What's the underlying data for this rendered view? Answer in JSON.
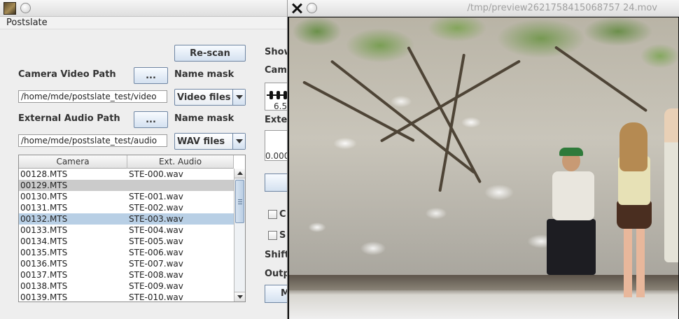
{
  "main_window": {
    "menu": {
      "app_menu": "Postslate"
    },
    "rescan_label": "Re-scan",
    "camera": {
      "path_label": "Camera Video Path",
      "browse_label": "...",
      "name_mask_label": "Name mask",
      "path_value": "/home/mde/postslate_test/video",
      "mask_value": "Video files"
    },
    "audio": {
      "path_label": "External Audio Path",
      "browse_label": "...",
      "name_mask_label": "Name mask",
      "path_value": "/home/mde/postslate_test/audio",
      "mask_value": "WAV files"
    },
    "table": {
      "columns": [
        "Camera",
        "Ext. Audio"
      ],
      "rows": [
        [
          "00128.MTS",
          "STE-000.wav"
        ],
        [
          "00129.MTS",
          ""
        ],
        [
          "00130.MTS",
          "STE-001.wav"
        ],
        [
          "00131.MTS",
          "STE-002.wav"
        ],
        [
          "00132.MTS",
          "STE-003.wav"
        ],
        [
          "00133.MTS",
          "STE-004.wav"
        ],
        [
          "00134.MTS",
          "STE-005.wav"
        ],
        [
          "00135.MTS",
          "STE-006.wav"
        ],
        [
          "00136.MTS",
          "STE-007.wav"
        ],
        [
          "00137.MTS",
          "STE-008.wav"
        ],
        [
          "00138.MTS",
          "STE-009.wav"
        ],
        [
          "00139.MTS",
          "STE-010.wav"
        ]
      ],
      "highlighted_row_gray": 1,
      "selected_row": 4
    },
    "right_panel_partial": {
      "show_label": "Show",
      "cam_label": "Cam",
      "wave_value": "6.5",
      "ext_label": "Exte",
      "audio_value": "0.000",
      "check1_label": "C",
      "check2_label": "S",
      "shift_label": "Shift",
      "output_label": "Outp",
      "bottom_button_label": "M"
    }
  },
  "preview_window": {
    "title": "/tmp/preview2621758415068757 24.mov"
  }
}
